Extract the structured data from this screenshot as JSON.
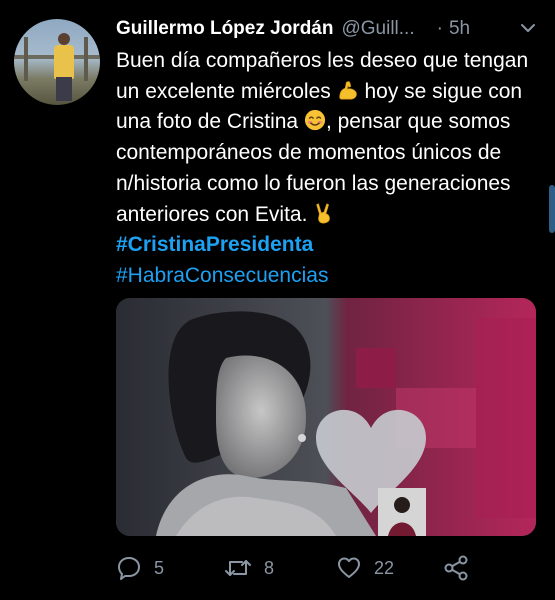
{
  "tweet": {
    "author_name": "Guillermo López Jordán",
    "handle": "@Guill...",
    "separator": "·",
    "time": "5h",
    "text_parts": {
      "p1": "Buen día compañeros les deseo que tengan un excelente miércoles ",
      "p2": " hoy se sigue con una foto de Cristina ",
      "p3": ", pensar que somos contemporáneos de momentos únicos de n/historia como lo fueron las generaciones anteriores con Evita. ",
      "p4": " "
    },
    "hashtags": [
      "#CristinaPresidenta",
      "#HabraConsecuencias"
    ],
    "emoji": [
      "flexed-biceps",
      "smiling-face",
      "victory-hand"
    ]
  },
  "actions": {
    "replies": "5",
    "retweets": "8",
    "likes": "22"
  },
  "icons": {
    "reply": "speech-bubble-icon",
    "retweet": "retweet-arrows-icon",
    "like": "heart-icon",
    "share": "share-icon",
    "menu": "chevron-down-icon"
  },
  "colors": {
    "background": "#000000",
    "hashtag": "#1da1f2",
    "muted": "#8a96a3",
    "media_pink": "#c02a62",
    "media_gray": "#4b4d55"
  }
}
